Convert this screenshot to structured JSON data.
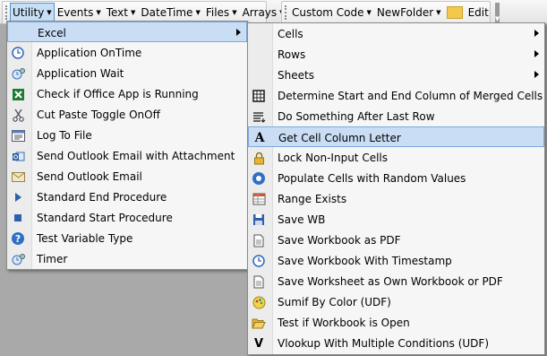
{
  "toolbar": {
    "group1": [
      {
        "label": "Utility"
      },
      {
        "label": "Events"
      },
      {
        "label": "Text"
      },
      {
        "label": "DateTime"
      },
      {
        "label": "Files"
      },
      {
        "label": "Arrays"
      }
    ],
    "group2": {
      "custom_code": "Custom Code",
      "new_folder": "NewFolder",
      "edit": "Edit"
    }
  },
  "utility_menu": {
    "items": [
      {
        "label": "Excel",
        "icon": "none",
        "submenu": true
      },
      {
        "label": "Application OnTime",
        "icon": "clock-icon"
      },
      {
        "label": "Application Wait",
        "icon": "wait-icon"
      },
      {
        "label": "Check if Office App is Running",
        "icon": "excel-icon"
      },
      {
        "label": "Cut Paste Toggle OnOff",
        "icon": "scissors-icon"
      },
      {
        "label": "Log To File",
        "icon": "log-icon"
      },
      {
        "label": "Send Outlook Email with Attachment",
        "icon": "outlook-icon"
      },
      {
        "label": "Send Outlook Email",
        "icon": "envelope-icon"
      },
      {
        "label": "Standard End Procedure",
        "icon": "play-icon"
      },
      {
        "label": "Standard Start Procedure",
        "icon": "stop-icon"
      },
      {
        "label": "Test Variable Type",
        "icon": "help-icon"
      },
      {
        "label": "Timer",
        "icon": "timer-icon"
      }
    ]
  },
  "excel_menu": {
    "items": [
      {
        "label": "Cells",
        "icon": "none",
        "submenu": true
      },
      {
        "label": "Rows",
        "icon": "none",
        "submenu": true
      },
      {
        "label": "Sheets",
        "icon": "none",
        "submenu": true
      },
      {
        "label": "Determine Start and End Column of Merged Cells",
        "icon": "merge-icon"
      },
      {
        "label": "Do Something After Last Row",
        "icon": "rows-icon"
      },
      {
        "label": "Get Cell Column Letter",
        "icon": "letter-a-icon"
      },
      {
        "label": "Lock Non-Input Cells",
        "icon": "lock-icon"
      },
      {
        "label": "Populate Cells with Random Values",
        "icon": "random-icon"
      },
      {
        "label": "Range Exists",
        "icon": "range-icon"
      },
      {
        "label": "Save WB",
        "icon": "save-icon"
      },
      {
        "label": "Save Workbook as PDF",
        "icon": "pdf-icon"
      },
      {
        "label": "Save Workbook With Timestamp",
        "icon": "clock-icon"
      },
      {
        "label": "Save Worksheet as Own Workbook or PDF",
        "icon": "document-icon"
      },
      {
        "label": "Sumif By Color (UDF)",
        "icon": "palette-icon"
      },
      {
        "label": "Test if Workbook is Open",
        "icon": "folder-open-icon"
      },
      {
        "label": "Vlookup With Multiple Conditions (UDF)",
        "icon": "letter-v-icon"
      }
    ]
  },
  "colors": {
    "highlight": "#c9def5",
    "highlight_border": "#7fa9d8",
    "menu_bg": "#f6f6f6"
  }
}
